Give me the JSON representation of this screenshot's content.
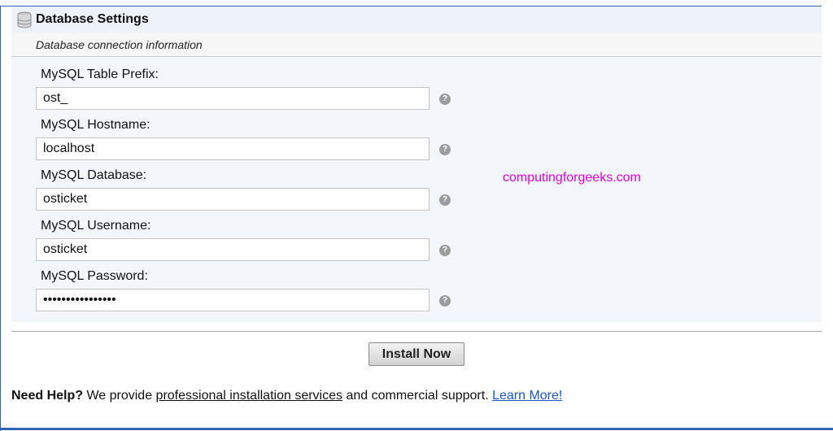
{
  "section": {
    "title": "Database Settings",
    "subtitle": "Database connection information"
  },
  "fields": [
    {
      "label": "MySQL Table Prefix:",
      "value": "ost_"
    },
    {
      "label": "MySQL Hostname:",
      "value": "localhost"
    },
    {
      "label": "MySQL Database:",
      "value": "osticket"
    },
    {
      "label": "MySQL Username:",
      "value": "osticket"
    },
    {
      "label": "MySQL Password:",
      "value": "••••••••••••••••"
    }
  ],
  "help_icon_glyph": "?",
  "watermark": "computingforgeeks.com",
  "install_button": "Install Now",
  "footer": {
    "need_help": "Need Help?",
    "text_before": " We provide ",
    "pro_link": "professional installation services",
    "text_after": " and commercial support. ",
    "learn_link": "Learn More!"
  },
  "colors": {
    "frame": "#2f63b5",
    "watermark": "#e000d8",
    "link": "#1a56c4"
  }
}
